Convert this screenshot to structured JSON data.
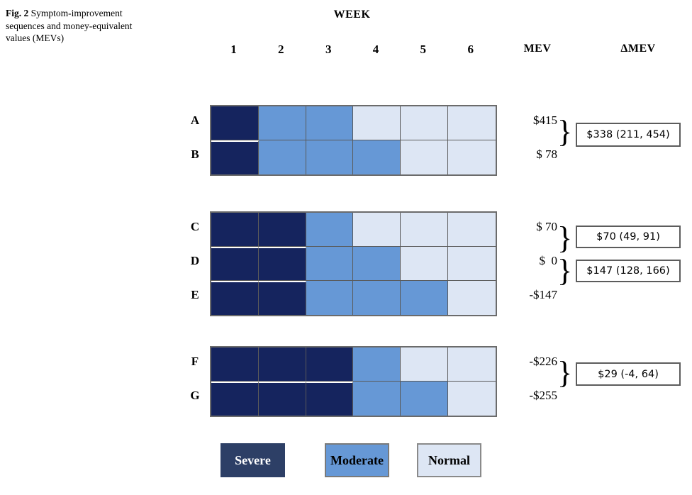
{
  "caption": {
    "fig_label": "Fig. 2",
    "text": "Symptom-improvement sequences and money-equivalent values (MEVs)"
  },
  "header": {
    "week_title": "WEEK",
    "columns": [
      "1",
      "2",
      "3",
      "4",
      "5",
      "6"
    ],
    "mev_label": "MEV",
    "dmev_label": "ΔMEV"
  },
  "legend": {
    "items": [
      {
        "label": "Severe",
        "color": "#2d3f66"
      },
      {
        "label": "Moderate",
        "color": "#6698d6"
      },
      {
        "label": "Normal",
        "color": "#dde6f4"
      }
    ]
  },
  "chart_data": {
    "type": "heatmap",
    "title": "Symptom-improvement sequences and money-equivalent values (MEVs)",
    "xlabel": "WEEK",
    "ylabel": "",
    "x": [
      "1",
      "2",
      "3",
      "4",
      "5",
      "6"
    ],
    "categories": [
      "A",
      "B",
      "C",
      "D",
      "E",
      "F",
      "G"
    ],
    "value_levels": [
      "Severe",
      "Moderate",
      "Normal"
    ],
    "level_colors": {
      "Severe": "#15245e",
      "Moderate": "#6698d6",
      "Normal": "#dde6f4"
    },
    "grid": true,
    "legend_position": "bottom",
    "series": [
      {
        "name": "A",
        "values": [
          "Severe",
          "Moderate",
          "Moderate",
          "Normal",
          "Normal",
          "Normal"
        ],
        "mev": "$415"
      },
      {
        "name": "B",
        "values": [
          "Severe",
          "Moderate",
          "Moderate",
          "Moderate",
          "Normal",
          "Normal"
        ],
        "mev": "$ 78"
      },
      {
        "name": "C",
        "values": [
          "Severe",
          "Severe",
          "Moderate",
          "Normal",
          "Normal",
          "Normal"
        ],
        "mev": "$ 70"
      },
      {
        "name": "D",
        "values": [
          "Severe",
          "Severe",
          "Moderate",
          "Moderate",
          "Normal",
          "Normal"
        ],
        "mev": "$  0"
      },
      {
        "name": "E",
        "values": [
          "Severe",
          "Severe",
          "Moderate",
          "Moderate",
          "Moderate",
          "Normal"
        ],
        "mev": "-$147"
      },
      {
        "name": "F",
        "values": [
          "Severe",
          "Severe",
          "Severe",
          "Moderate",
          "Normal",
          "Normal"
        ],
        "mev": "-$226"
      },
      {
        "name": "G",
        "values": [
          "Severe",
          "Severe",
          "Severe",
          "Moderate",
          "Moderate",
          "Normal"
        ],
        "mev": "-$255"
      }
    ],
    "dmev_comparisons": [
      {
        "pair": "A vs B",
        "label": "$338 (211, 454)",
        "estimate": 338,
        "ci_low": 211,
        "ci_high": 454
      },
      {
        "pair": "C vs D",
        "label": "$70 (49, 91)",
        "estimate": 70,
        "ci_low": 49,
        "ci_high": 91
      },
      {
        "pair": "D vs E",
        "label": "$147 (128, 166)",
        "estimate": 147,
        "ci_low": 128,
        "ci_high": 166
      },
      {
        "pair": "F vs G",
        "label": "$29 (-4, 64)",
        "estimate": 29,
        "ci_low": -4,
        "ci_high": 64
      }
    ]
  },
  "rows": {
    "a": {
      "letter": "A",
      "mev": "$415"
    },
    "b": {
      "letter": "B",
      "mev": "$ 78"
    },
    "c": {
      "letter": "C",
      "mev": "$ 70"
    },
    "d": {
      "letter": "D",
      "mev": "$  0"
    },
    "e": {
      "letter": "E",
      "mev": "-$147"
    },
    "f": {
      "letter": "F",
      "mev": "-$226"
    },
    "g": {
      "letter": "G",
      "mev": "-$255"
    }
  },
  "dmev_boxes": {
    "ab": "$338 (211, 454)",
    "cd": "$70 (49, 91)",
    "de": "$147 (128, 166)",
    "fg": "$29 (-4, 64)"
  },
  "brace_glyph": "}"
}
